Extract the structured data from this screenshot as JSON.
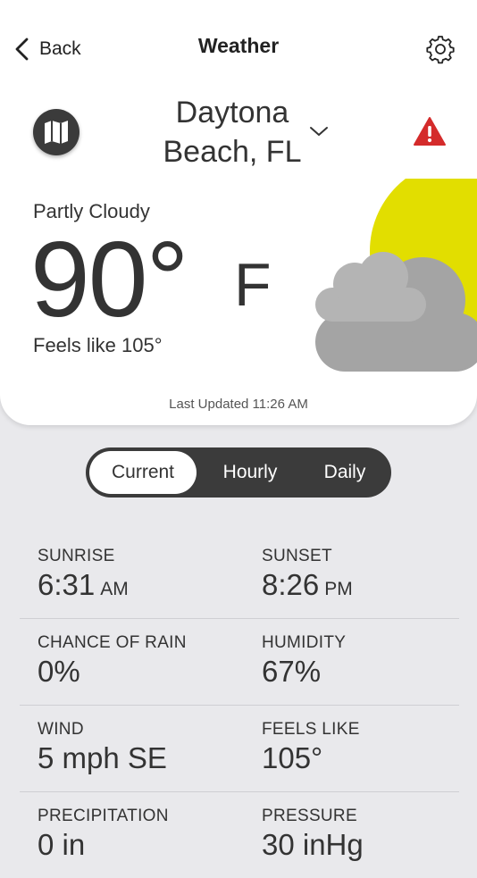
{
  "nav": {
    "back_label": "Back",
    "title": "Weather"
  },
  "location": {
    "name": "Daytona Beach, FL"
  },
  "current": {
    "condition": "Partly Cloudy",
    "temperature": "90°",
    "unit": "F",
    "feels_like": "Feels like 105°",
    "last_updated": "Last Updated 11:26 AM"
  },
  "tabs": {
    "current": "Current",
    "hourly": "Hourly",
    "daily": "Daily"
  },
  "stats": [
    {
      "left_label": "SUNRISE",
      "left_value": "6:31",
      "left_suffix": "AM",
      "right_label": "SUNSET",
      "right_value": "8:26",
      "right_suffix": "PM"
    },
    {
      "left_label": "CHANCE OF RAIN",
      "left_value": "0%",
      "left_suffix": "",
      "right_label": "HUMIDITY",
      "right_value": "67%",
      "right_suffix": ""
    },
    {
      "left_label": "WIND",
      "left_value": "5 mph SE",
      "left_suffix": "",
      "right_label": "FEELS LIKE",
      "right_value": "105°",
      "right_suffix": ""
    },
    {
      "left_label": "PRECIPITATION",
      "left_value": "0 in",
      "left_suffix": "",
      "right_label": "PRESSURE",
      "right_value": "30 inHg",
      "right_suffix": ""
    }
  ],
  "colors": {
    "sun": "#e2de00",
    "cloud": "#a9a9a9",
    "alert": "#d42b2b",
    "dark": "#3b3b3b"
  },
  "icons": {
    "back": "chevron-left-icon",
    "settings": "gear-icon",
    "map": "map-icon",
    "dropdown": "chevron-down-icon",
    "alert": "warning-icon",
    "weather": "partly-cloudy-icon"
  }
}
